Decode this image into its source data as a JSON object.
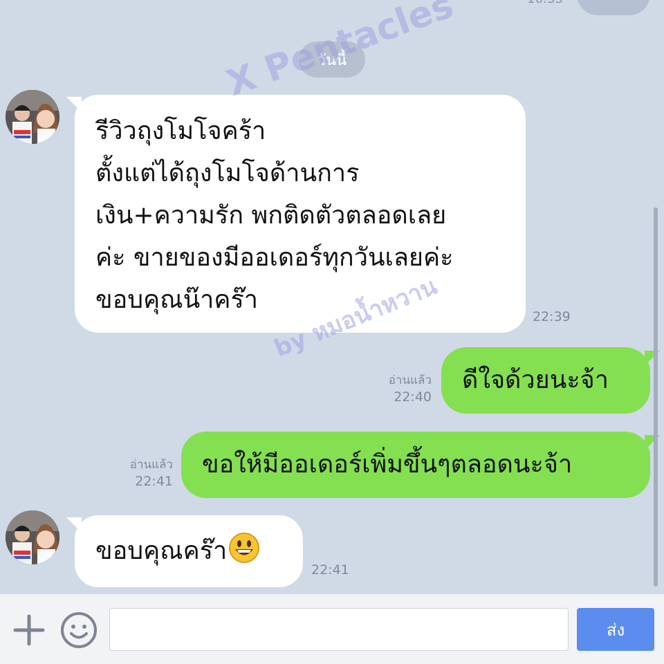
{
  "chat": {
    "top_time": "16:33",
    "date_separator": "วันนี้",
    "messages": [
      {
        "side": "incoming",
        "lines": [
          "รีวิวถุงโมโจคร้า",
          "ตั้งแต่ได้ถุงโมโจด้านการ",
          "เงิน+ความรัก พกติดตัวตลอดเลย",
          "ค่ะ ขายของมีออเดอร์ทุกวันเลยค่ะ",
          "ขอบคุณน๊าคร๊า"
        ],
        "time": "22:39"
      },
      {
        "side": "outgoing",
        "text": "ดีใจด้วยนะจ้า",
        "status": "อ่านแล้ว",
        "time": "22:40"
      },
      {
        "side": "outgoing",
        "text": "ขอให้มีออเดอร์เพิ่มขึ้นๆตลอดนะจ้า",
        "status": "อ่านแล้ว",
        "time": "22:41"
      },
      {
        "side": "incoming",
        "text": "ขอบคุณคร๊า",
        "emoji": "smiley-emoji",
        "time": "22:41"
      }
    ]
  },
  "watermarks": {
    "line1": "X Pentacles",
    "line2": "by หมอน้ำหวาน"
  },
  "input_bar": {
    "plus_icon": "plus-icon",
    "emoji_icon": "smiley-face-icon",
    "placeholder": "",
    "send_label": "ส่ง"
  },
  "colors": {
    "background": "#d0d9e6",
    "incoming_bubble": "#ffffff",
    "outgoing_bubble": "#84e050",
    "send_button": "#5b8def"
  }
}
